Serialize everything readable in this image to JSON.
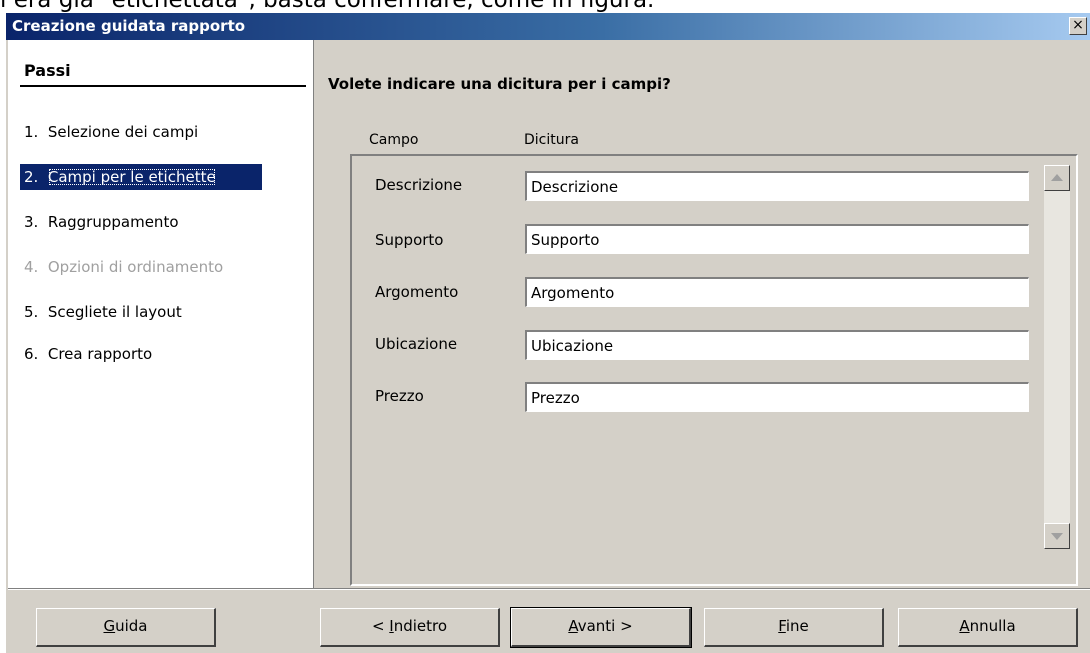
{
  "caption": "i era già \"etichettata\", basta confermare, come in figura.",
  "window": {
    "title": "Creazione guidata rapporto",
    "close_glyph": "×"
  },
  "steps": {
    "title": "Passi",
    "items": [
      {
        "num": "1.",
        "label": "Selezione dei campi",
        "state": "normal"
      },
      {
        "num": "2.",
        "label": "Campi per le etichette",
        "state": "active"
      },
      {
        "num": "3.",
        "label": "Raggruppamento",
        "state": "normal"
      },
      {
        "num": "4.",
        "label": "Opzioni di ordinamento",
        "state": "disabled"
      },
      {
        "num": "5.",
        "label": "Scegliete il layout",
        "state": "normal"
      },
      {
        "num": "6.",
        "label": "Crea rapporto",
        "state": "normal"
      }
    ]
  },
  "main": {
    "question": "Volete indicare una dicitura per i campi?",
    "col_field": "Campo",
    "col_caption": "Dicitura",
    "fields": [
      {
        "name": "Descrizione",
        "caption": "Descrizione"
      },
      {
        "name": "Supporto",
        "caption": "Supporto"
      },
      {
        "name": "Argomento",
        "caption": "Argomento"
      },
      {
        "name": "Ubicazione",
        "caption": "Ubicazione"
      },
      {
        "name": "Prezzo",
        "caption": "Prezzo"
      }
    ]
  },
  "buttons": {
    "help": {
      "accel": "G",
      "rest": "uida"
    },
    "back": {
      "pre": "< ",
      "accel": "I",
      "rest": "ndietro"
    },
    "next": {
      "accel": "A",
      "rest": "vanti >"
    },
    "finish": {
      "accel": "F",
      "rest": "ine"
    },
    "cancel": {
      "accel": "A",
      "rest": "nnulla"
    }
  },
  "colors": {
    "title_bar": "#0a246a",
    "face": "#d4d0c8",
    "selection": "#0a246a"
  }
}
